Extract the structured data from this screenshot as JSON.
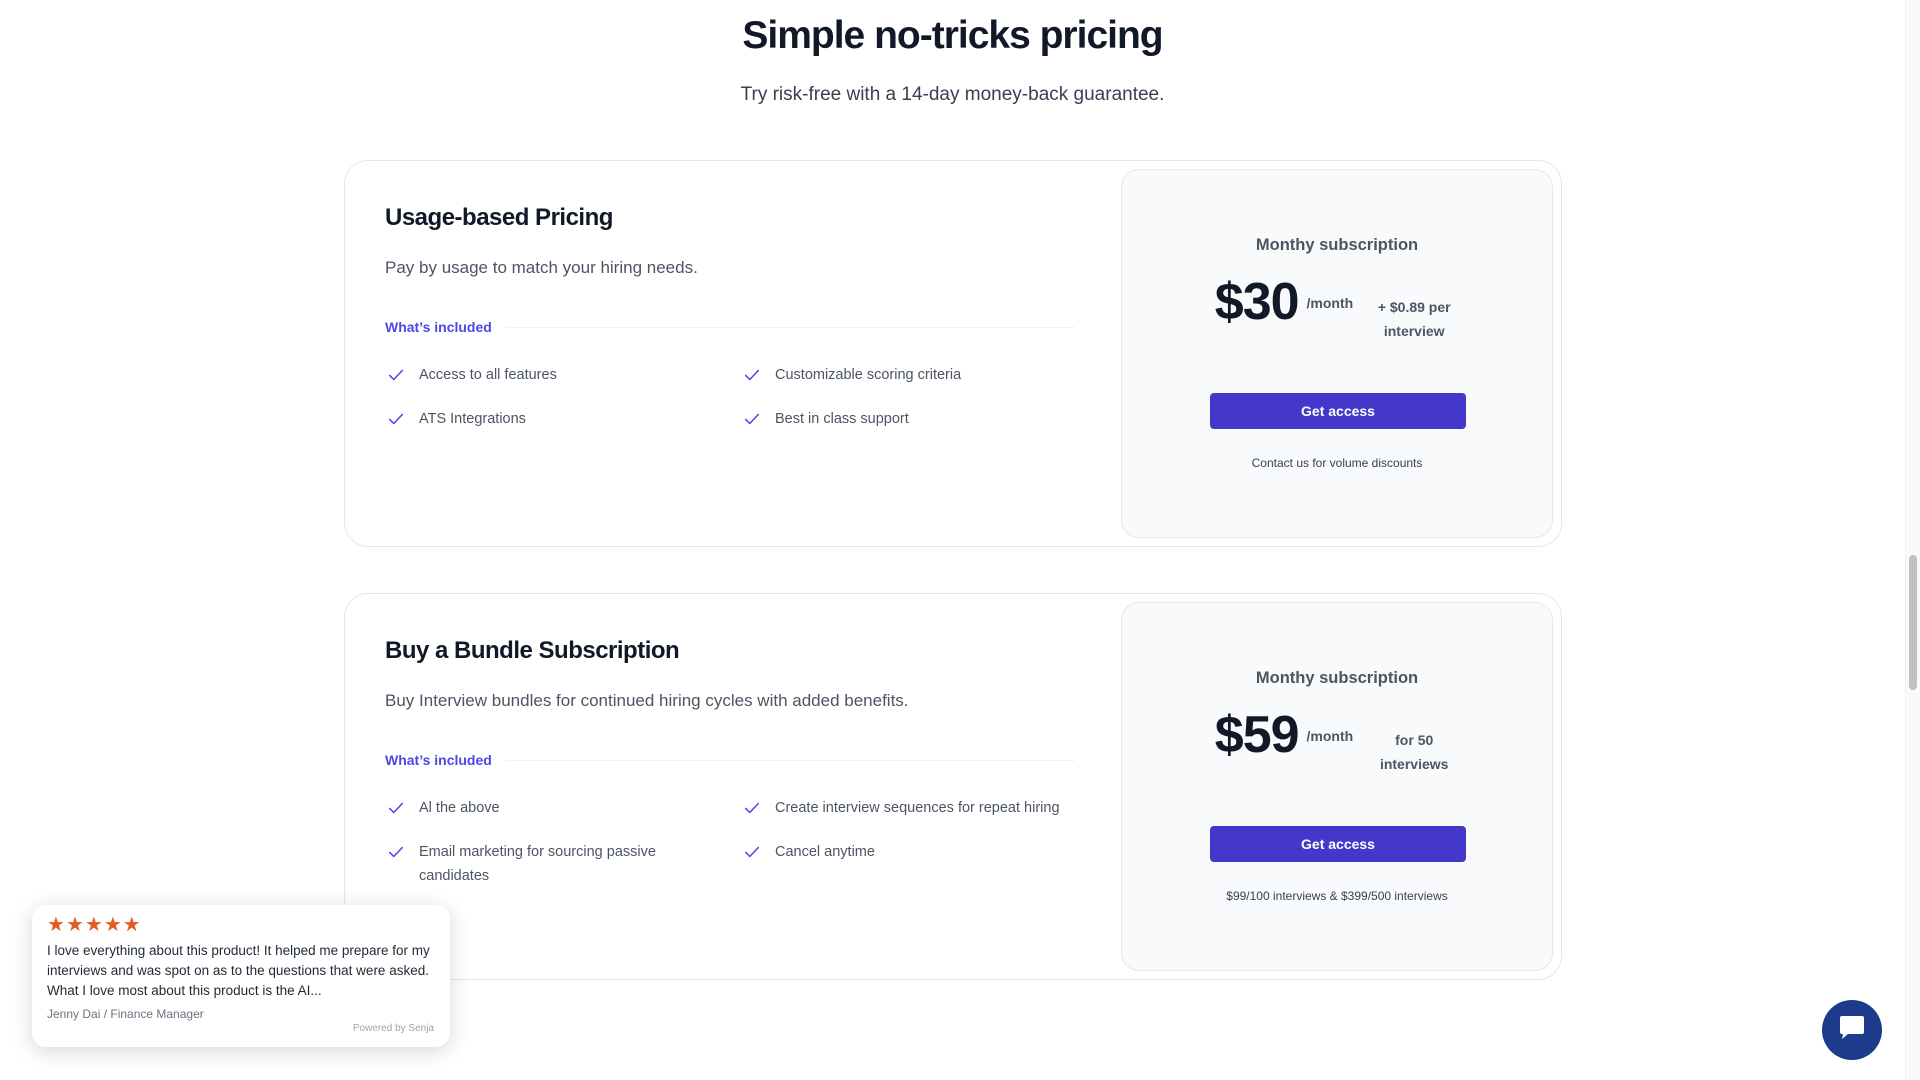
{
  "header": {
    "title": "Simple no-tricks pricing",
    "subtitle": "Try risk-free with a 14-day money-back guarantee."
  },
  "plans": [
    {
      "title": "Usage-based Pricing",
      "description": "Pay by usage to match your hiring needs.",
      "included_label": "What’s included",
      "features": [
        "Access to all features",
        "Customizable scoring criteria",
        "ATS Integrations",
        "Best in class support"
      ],
      "price_heading": "Monthy subscription",
      "price": "$30",
      "period": "/month",
      "extra": "+ $0.89 per interview",
      "cta": "Get access",
      "note": "Contact us for volume discounts"
    },
    {
      "title": "Buy a Bundle Subscription",
      "description": "Buy Interview bundles for continued hiring cycles with added benefits.",
      "included_label": "What’s included",
      "features": [
        "Al the above",
        "Create interview sequences for repeat hiring",
        "Email marketing for sourcing passive candidates",
        "Cancel anytime"
      ],
      "price_heading": "Monthy subscription",
      "price": "$59",
      "period": "/month",
      "extra": "for 50 interviews",
      "cta": "Get access",
      "note": "$99/100 interviews & $399/500 interviews"
    }
  ],
  "review": {
    "rating": 5,
    "text": "I love everything about this product! It helped me prepare for my interviews and was spot on as to the questions that were asked. What I love most about this product is the AI...",
    "author": "Jenny Dai / Finance Manager",
    "powered_by": "Powered by Senja"
  },
  "icons": {
    "check": "check-icon",
    "star": "star-icon",
    "chat": "chat-bubble-icon"
  },
  "colors": {
    "accent": "#4f46e5",
    "button": "#4338ca",
    "star": "#e05d26",
    "chat": "#1e3a8a"
  }
}
